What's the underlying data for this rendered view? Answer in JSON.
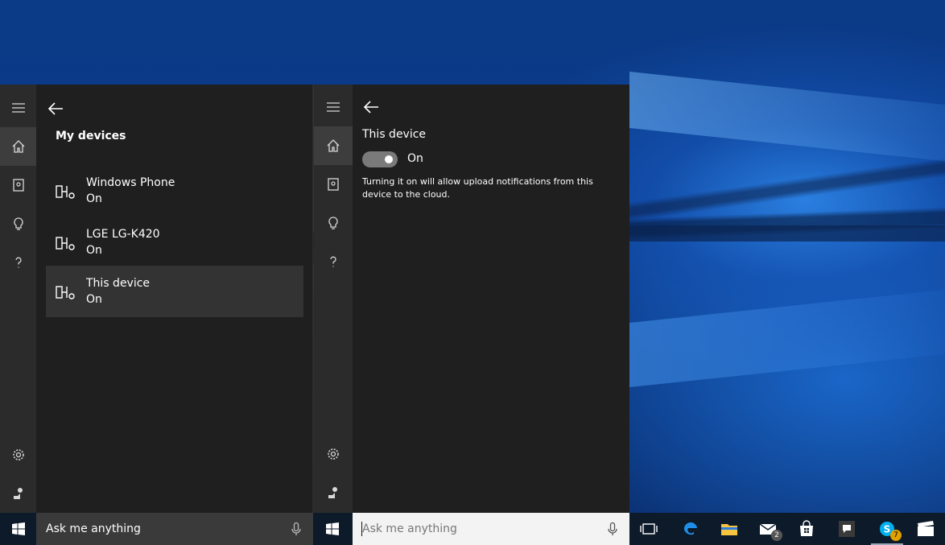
{
  "left_panel": {
    "title": "My devices",
    "devices": [
      {
        "name": "Windows Phone",
        "state": "On"
      },
      {
        "name": "LGE LG-K420",
        "state": "On"
      },
      {
        "name": "This device",
        "state": "On"
      }
    ]
  },
  "right_panel": {
    "title": "This device",
    "toggle_state": "On",
    "description": "Turning it on will allow upload notifications from this device to the cloud."
  },
  "rail_icons": [
    "menu-icon",
    "home-icon",
    "notebook-icon",
    "lightbulb-icon",
    "help-icon",
    "settings-icon",
    "feedback-icon"
  ],
  "taskbar": {
    "search_left_text": "Ask me anything",
    "search_right_placeholder": "Ask me anything",
    "mail_badge": "2",
    "skype_badge": "7"
  },
  "colors": {
    "panel_bg": "#1f1f1f",
    "rail_bg": "#2b2b2b",
    "selected_bg": "#333333",
    "taskbar_bg": "#0d1a2a"
  }
}
